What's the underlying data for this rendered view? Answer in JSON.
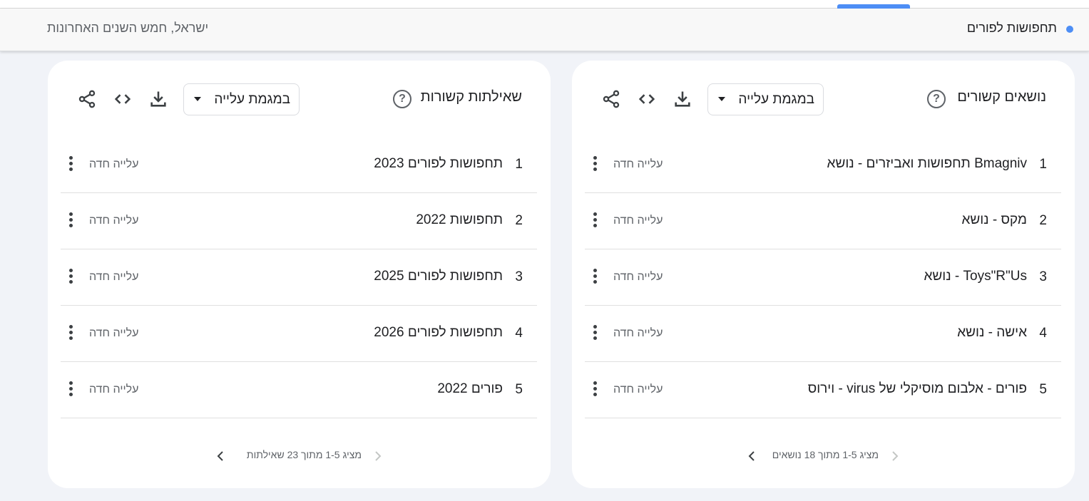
{
  "header": {
    "term": "תחפושות לפורים",
    "region_time": "ישראל, חמש השנים האחרונות"
  },
  "topics_card": {
    "title": "נושאים קשורים",
    "filter": "במגמת עלייה",
    "rows": [
      {
        "rank": "1",
        "label": "Bmagniv תחפושות ואביזרים - נושא",
        "value": "עלייה חדה"
      },
      {
        "rank": "2",
        "label": "מקס - נושא",
        "value": "עלייה חדה"
      },
      {
        "rank": "3",
        "label": "Toys\"R\"Us - נושא",
        "value": "עלייה חדה"
      },
      {
        "rank": "4",
        "label": "אישה - נושא",
        "value": "עלייה חדה"
      },
      {
        "rank": "5",
        "label": "פורים - אלבום מוסיקלי של virus - וירוס",
        "value": "עלייה חדה"
      }
    ],
    "pager": "מציג 1-5 מתוך 18 נושאים"
  },
  "queries_card": {
    "title": "שאילתות קשורות",
    "filter": "במגמת עלייה",
    "rows": [
      {
        "rank": "1",
        "label": "תחפושות לפורים 2023",
        "value": "עלייה חדה"
      },
      {
        "rank": "2",
        "label": "תחפושות 2022",
        "value": "עלייה חדה"
      },
      {
        "rank": "3",
        "label": "תחפושות לפורים 2025",
        "value": "עלייה חדה"
      },
      {
        "rank": "4",
        "label": "תחפושות לפורים 2026",
        "value": "עלייה חדה"
      },
      {
        "rank": "5",
        "label": "פורים 2022",
        "value": "עלייה חדה"
      }
    ],
    "pager": "מציג 1-5 מתוך 23 שאילתות"
  },
  "icons": {
    "help": "help-circle-icon",
    "download": "download-icon",
    "embed": "code-embed-icon",
    "share": "share-icon",
    "more": "more-vert-icon",
    "prev": "chevron-left-icon",
    "next": "chevron-right-icon"
  },
  "colors": {
    "accent": "#4d8ef5",
    "background": "#f1f3f8",
    "card": "#ffffff",
    "secondary_text": "#5f6368"
  }
}
